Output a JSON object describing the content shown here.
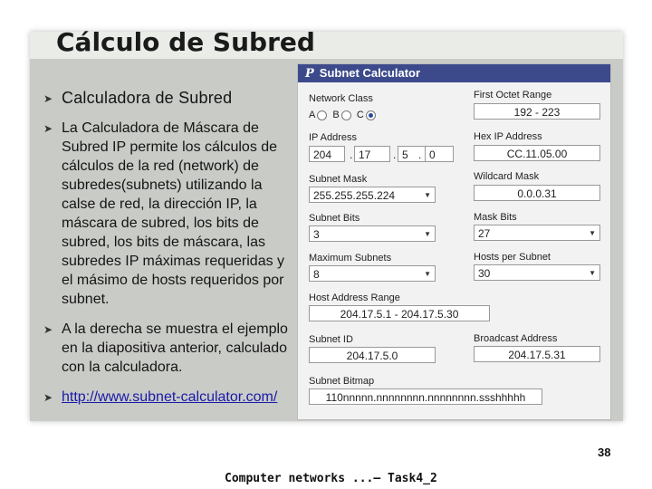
{
  "slide": {
    "title": "Cálculo de Subred",
    "bullets": [
      "Calculadora de Subred",
      "La Calculadora de Máscara de Subred IP permite los cálculos de cálculos de la red (network) de subredes(subnets) utilizando la calse de red, la dirección IP, la máscara de subred, los bits de subred, los bits de máscara, las subredes IP máximas requeridas y el másimo de hosts requeridos por subnet.",
      "A la derecha se muestra el ejemplo en la diapositiva anterior, calculado con la calculadora."
    ],
    "link": "http://www.subnet-calculator.com/",
    "footer": "Computer networks ...– Task4_2",
    "page_number": "38"
  },
  "calculator": {
    "title": "Subnet Calculator",
    "network_class": {
      "label": "Network Class",
      "options": [
        "A",
        "B",
        "C"
      ],
      "selected": "C"
    },
    "first_octet_range": {
      "label": "First Octet Range",
      "value": "192 - 223"
    },
    "ip_address": {
      "label": "IP Address",
      "octets": [
        "204",
        "17",
        "5",
        "0"
      ]
    },
    "hex_ip_address": {
      "label": "Hex IP Address",
      "value": "CC.11.05.00"
    },
    "subnet_mask": {
      "label": "Subnet Mask",
      "value": "255.255.255.224"
    },
    "wildcard_mask": {
      "label": "Wildcard Mask",
      "value": "0.0.0.31"
    },
    "subnet_bits": {
      "label": "Subnet Bits",
      "value": "3"
    },
    "mask_bits": {
      "label": "Mask Bits",
      "value": "27"
    },
    "maximum_subnets": {
      "label": "Maximum Subnets",
      "value": "8"
    },
    "hosts_per_subnet": {
      "label": "Hosts per Subnet",
      "value": "30"
    },
    "host_address_range": {
      "label": "Host Address Range",
      "value": "204.17.5.1 - 204.17.5.30"
    },
    "subnet_id": {
      "label": "Subnet ID",
      "value": "204.17.5.0"
    },
    "broadcast_address": {
      "label": "Broadcast Address",
      "value": "204.17.5.31"
    },
    "subnet_bitmap": {
      "label": "Subnet Bitmap",
      "value": "110nnnnn.nnnnnnnn.nnnnnnnn.ssshhhhh"
    }
  },
  "icons": {
    "bullet": "bullet-arrow-icon",
    "logo": "subnet-logo-icon",
    "dropdown": "chevron-down-icon"
  }
}
